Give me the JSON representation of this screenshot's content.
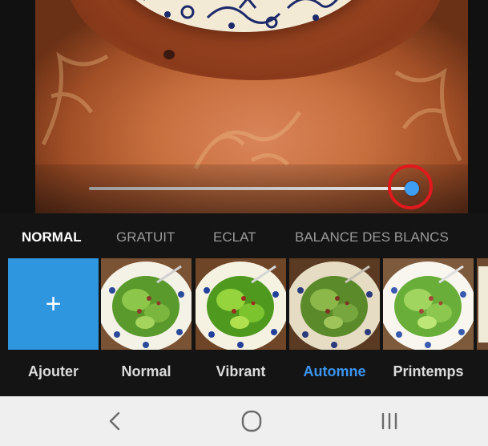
{
  "editor": {
    "intensity_level": 1.0
  },
  "tabs": [
    {
      "label": "NORMAL",
      "active": true
    },
    {
      "label": "GRATUIT",
      "active": false
    },
    {
      "label": "ECLAT",
      "active": false
    },
    {
      "label": "BALANCE DES BLANCS",
      "active": false
    }
  ],
  "filters": {
    "add_icon": "+",
    "items": [
      {
        "label": "Ajouter",
        "active": false
      },
      {
        "label": "Normal",
        "active": false
      },
      {
        "label": "Vibrant",
        "active": false
      },
      {
        "label": "Automne",
        "active": true
      },
      {
        "label": "Printemps",
        "active": false
      }
    ]
  },
  "colors": {
    "accent": "#3b95ef",
    "highlight_ring": "#e1191d",
    "add_tile": "#2e95df"
  },
  "navbar": {
    "icons": [
      "back-chevron-icon",
      "home-circle-icon",
      "recent-apps-icon"
    ]
  }
}
